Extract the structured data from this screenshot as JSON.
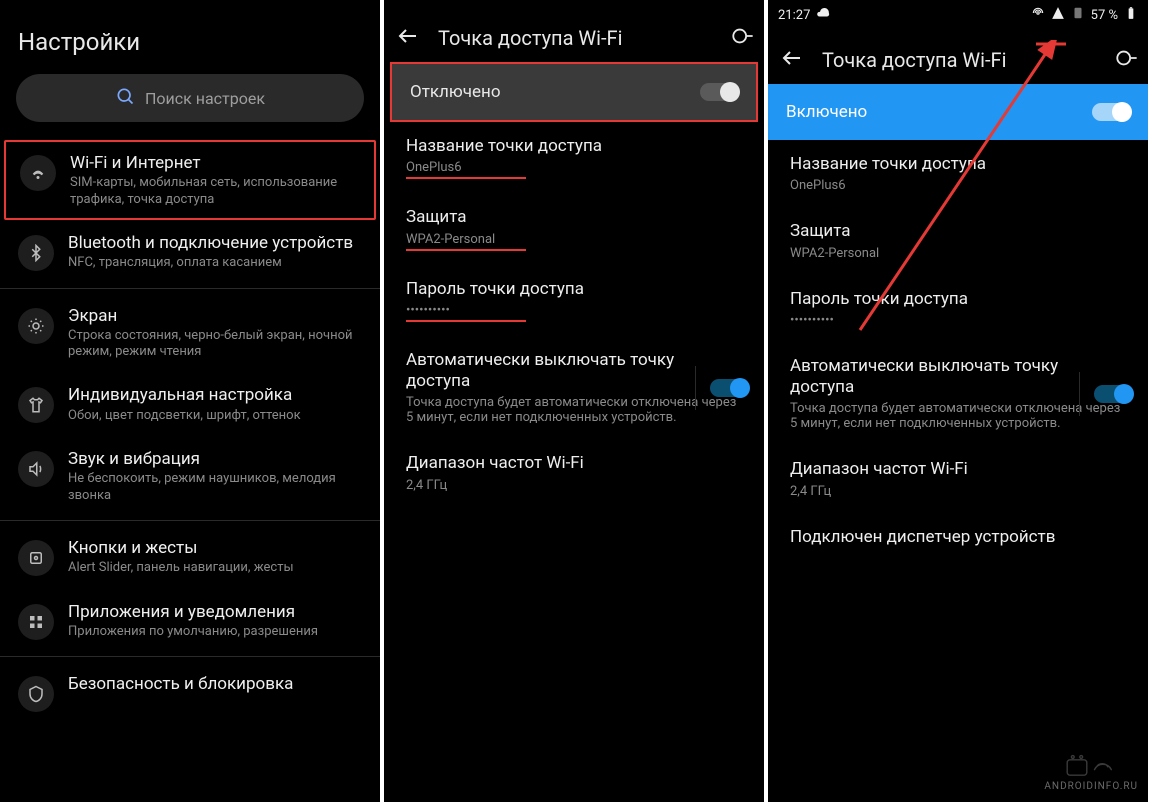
{
  "panel1": {
    "title": "Настройки",
    "search_placeholder": "Поиск настроек",
    "items": [
      {
        "title": "Wi-Fi и Интернет",
        "sub": "SIM-карты, мобильная сеть, использование трафика, точка доступа",
        "highlight": true,
        "icon": "wifi"
      },
      {
        "title": "Bluetooth и подключение устройств",
        "sub": "NFC, трансляция, оплата касанием",
        "icon": "bluetooth"
      },
      {
        "title": "Экран",
        "sub": "Строка состояния, черно-белый экран, ночной режим, режим чтения",
        "icon": "brightness"
      },
      {
        "title": "Индивидуальная настройка",
        "sub": "Обои, цвет подсветки, шрифт, оттенок",
        "icon": "shirt"
      },
      {
        "title": "Звук и вибрация",
        "sub": "Не беспокоить, режим наушников, мелодия звонка",
        "icon": "sound"
      },
      {
        "title": "Кнопки и жесты",
        "sub": "Alert Slider, панель навигации, жесты",
        "icon": "buttons"
      },
      {
        "title": "Приложения и уведомления",
        "sub": "Приложения по умолчанию, разрешения",
        "icon": "apps"
      },
      {
        "title": "Безопасность и блокировка",
        "sub": "",
        "icon": "security"
      }
    ]
  },
  "panel2": {
    "title": "Точка доступа Wi-Fi",
    "toggle_label": "Отключено",
    "settings": [
      {
        "title": "Название точки доступа",
        "sub": "OnePlus6",
        "redline": true
      },
      {
        "title": "Защита",
        "sub": "WPA2-Personal",
        "redline": true
      },
      {
        "title": "Пароль точки доступа",
        "sub": "••••••••••",
        "redline": true
      },
      {
        "title": "Автоматически выключать точку доступа",
        "sub": "Точка доступа будет автоматически отключена через 5 минут, если нет подключенных устройств.",
        "switch": true
      },
      {
        "title": "Диапазон частот Wi-Fi",
        "sub": "2,4 ГГц"
      }
    ]
  },
  "panel3": {
    "status": {
      "time": "21:27",
      "battery": "57 %"
    },
    "title": "Точка доступа Wi-Fi",
    "toggle_label": "Включено",
    "settings": [
      {
        "title": "Название точки доступа",
        "sub": "OnePlus6"
      },
      {
        "title": "Защита",
        "sub": "WPA2-Personal"
      },
      {
        "title": "Пароль точки доступа",
        "sub": "••••••••••"
      },
      {
        "title": "Автоматически выключать точку доступа",
        "sub": "Точка доступа будет автоматически отключена через 5 минут, если нет подключенных устройств.",
        "switch": true
      },
      {
        "title": "Диапазон частот Wi-Fi",
        "sub": "2,4 ГГц"
      },
      {
        "title": "Подключен диспетчер устройств",
        "sub": ""
      }
    ]
  },
  "watermark": "ANDROIDINFO.RU"
}
